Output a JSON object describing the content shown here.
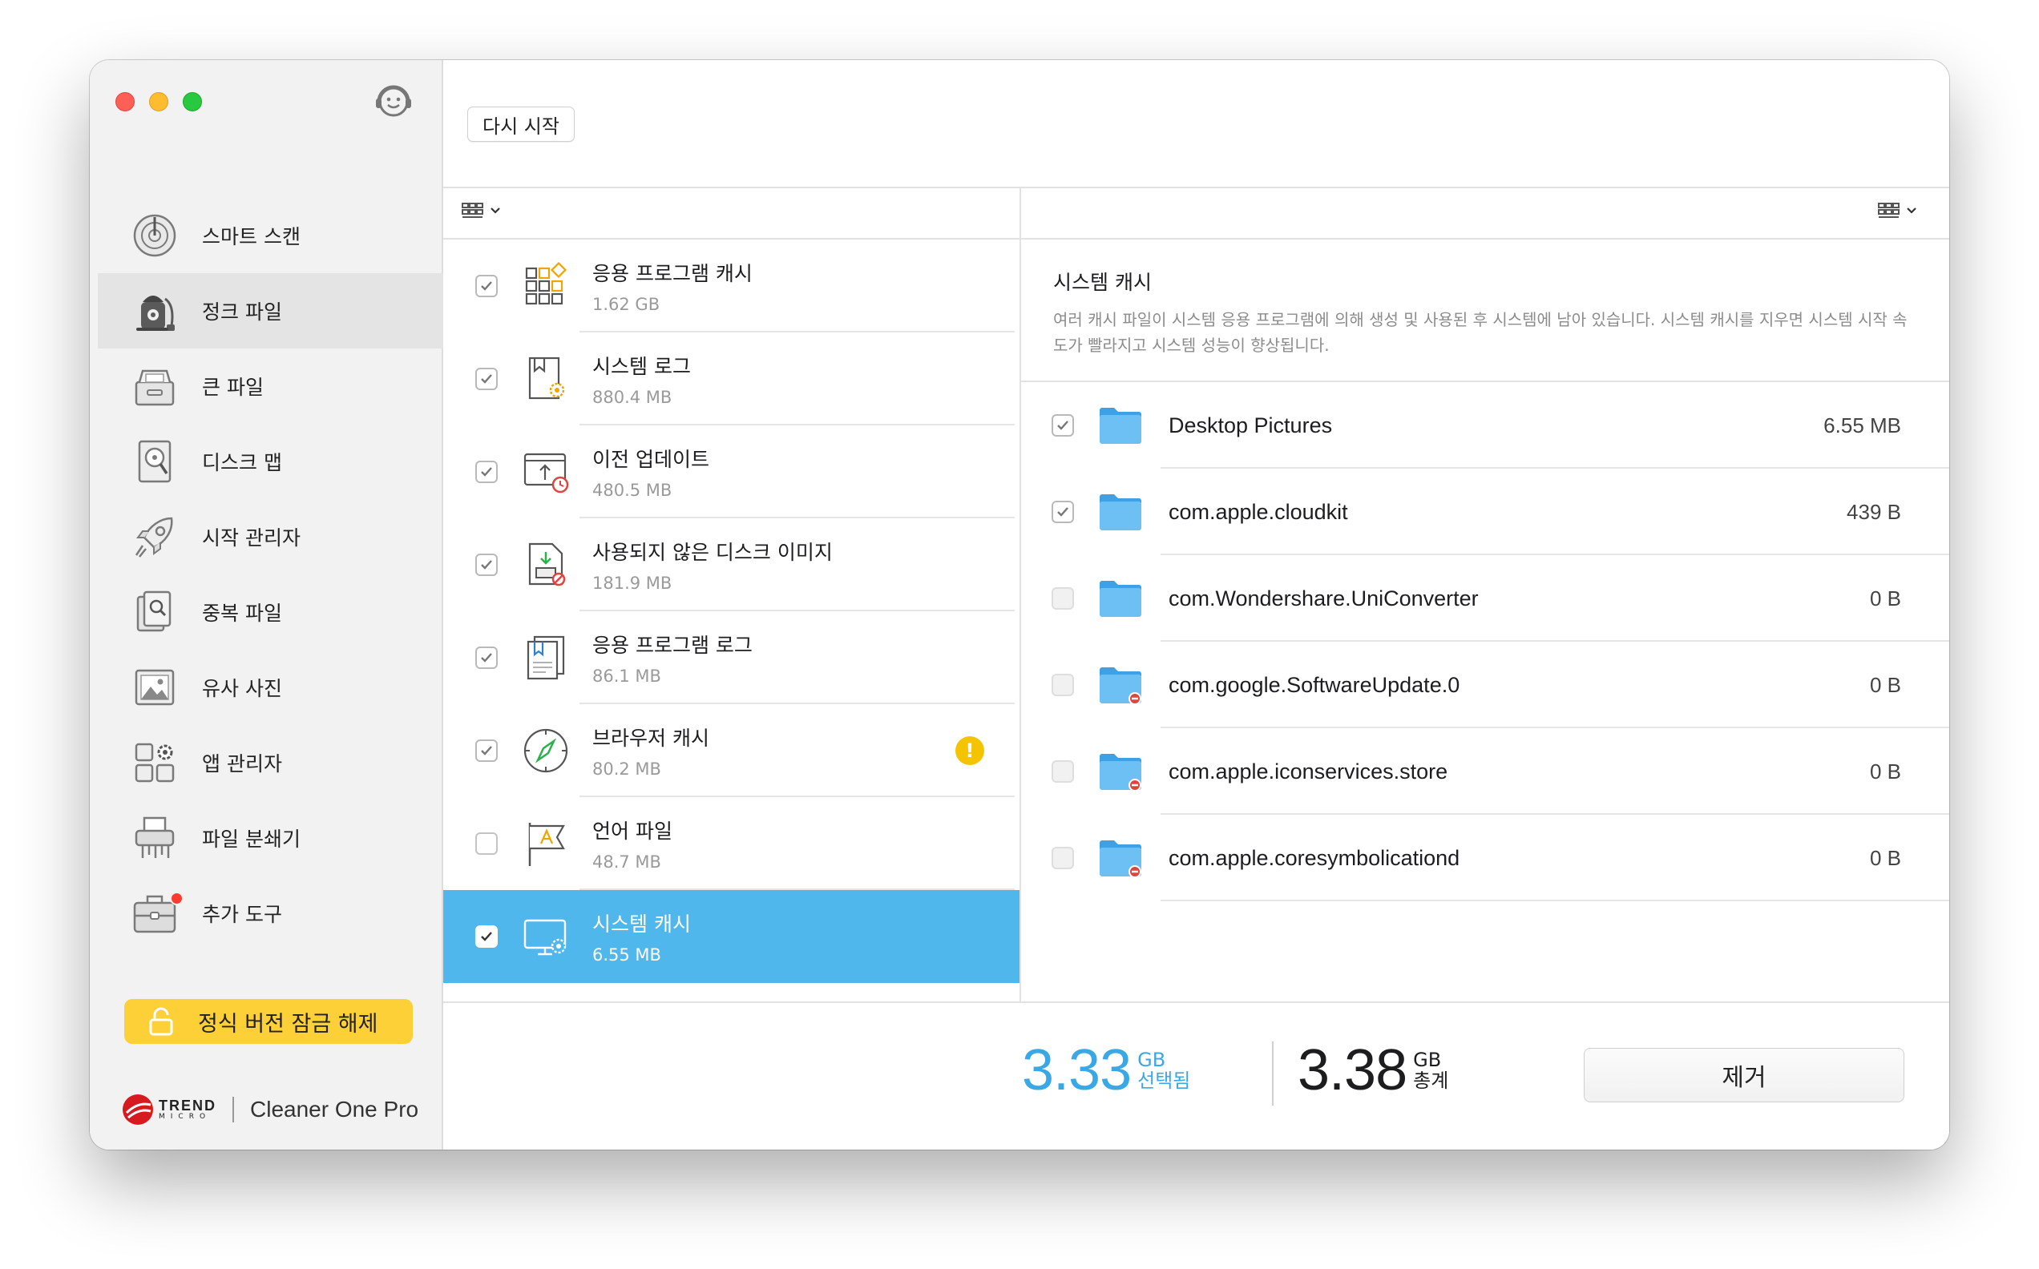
{
  "sidebar": {
    "items": [
      {
        "label": "스마트 스캔",
        "icon": "smart-scan-icon"
      },
      {
        "label": "정크 파일",
        "icon": "junk-files-icon"
      },
      {
        "label": "큰 파일",
        "icon": "large-files-icon"
      },
      {
        "label": "디스크 맵",
        "icon": "disk-map-icon"
      },
      {
        "label": "시작 관리자",
        "icon": "startup-manager-icon"
      },
      {
        "label": "중복 파일",
        "icon": "duplicate-files-icon"
      },
      {
        "label": "유사 사진",
        "icon": "similar-photos-icon"
      },
      {
        "label": "앱 관리자",
        "icon": "app-manager-icon"
      },
      {
        "label": "파일 분쇄기",
        "icon": "file-shredder-icon"
      },
      {
        "label": "추가 도구",
        "icon": "more-tools-icon"
      }
    ],
    "active_index": 1,
    "unlock_label": "정식 버전 잠금 해제",
    "brand_name": "TREND",
    "brand_sub": "MICRO",
    "product_name": "Cleaner One Pro"
  },
  "toolbar": {
    "restart_label": "다시 시작"
  },
  "categories": [
    {
      "name": "응용 프로그램 캐시",
      "size": "1.62 GB",
      "checked": true,
      "icon": "app-cache-icon"
    },
    {
      "name": "시스템 로그",
      "size": "880.4 MB",
      "checked": true,
      "icon": "system-log-icon"
    },
    {
      "name": "이전 업데이트",
      "size": "480.5 MB",
      "checked": true,
      "icon": "old-updates-icon"
    },
    {
      "name": "사용되지 않은 디스크 이미지",
      "size": "181.9 MB",
      "checked": true,
      "icon": "unused-disk-image-icon"
    },
    {
      "name": "응용 프로그램 로그",
      "size": "86.1 MB",
      "checked": true,
      "icon": "app-log-icon"
    },
    {
      "name": "브라우저 캐시",
      "size": "80.2 MB",
      "checked": true,
      "icon": "browser-cache-icon",
      "warning": "!"
    },
    {
      "name": "언어 파일",
      "size": "48.7 MB",
      "checked": false,
      "icon": "language-files-icon"
    },
    {
      "name": "시스템 캐시",
      "size": "6.55 MB",
      "checked": true,
      "icon": "system-cache-icon",
      "selected": true
    }
  ],
  "detail": {
    "title": "시스템 캐시",
    "description": "여러 캐시 파일이 시스템 응용 프로그램에 의해 생성 및 사용된 후 시스템에 남아 있습니다. 시스템 캐시를 지우면 시스템 시작 속도가 빨라지고 시스템 성능이 향상됩니다.",
    "files": [
      {
        "name": "Desktop Pictures",
        "size": "6.55 MB",
        "checked": true,
        "locked": false
      },
      {
        "name": "com.apple.cloudkit",
        "size": "439 B",
        "checked": true,
        "locked": false
      },
      {
        "name": "com.Wondershare.UniConverter",
        "size": "0 B",
        "checked": false,
        "locked": false
      },
      {
        "name": "com.google.SoftwareUpdate.0",
        "size": "0 B",
        "checked": false,
        "locked": true
      },
      {
        "name": "com.apple.iconservices.store",
        "size": "0 B",
        "checked": false,
        "locked": true
      },
      {
        "name": "com.apple.coresymbolicationd",
        "size": "0 B",
        "checked": false,
        "locked": true
      }
    ]
  },
  "summary": {
    "selected_value": "3.33",
    "selected_unit": "GB",
    "selected_label": "선택됨",
    "total_value": "3.38",
    "total_unit": "GB",
    "total_label": "총계",
    "remove_label": "제거"
  },
  "colors": {
    "accent": "#4fb7ec",
    "selected_stat": "#3aa8e4",
    "unlock_button": "#fcd036",
    "warning": "#f5c400"
  }
}
